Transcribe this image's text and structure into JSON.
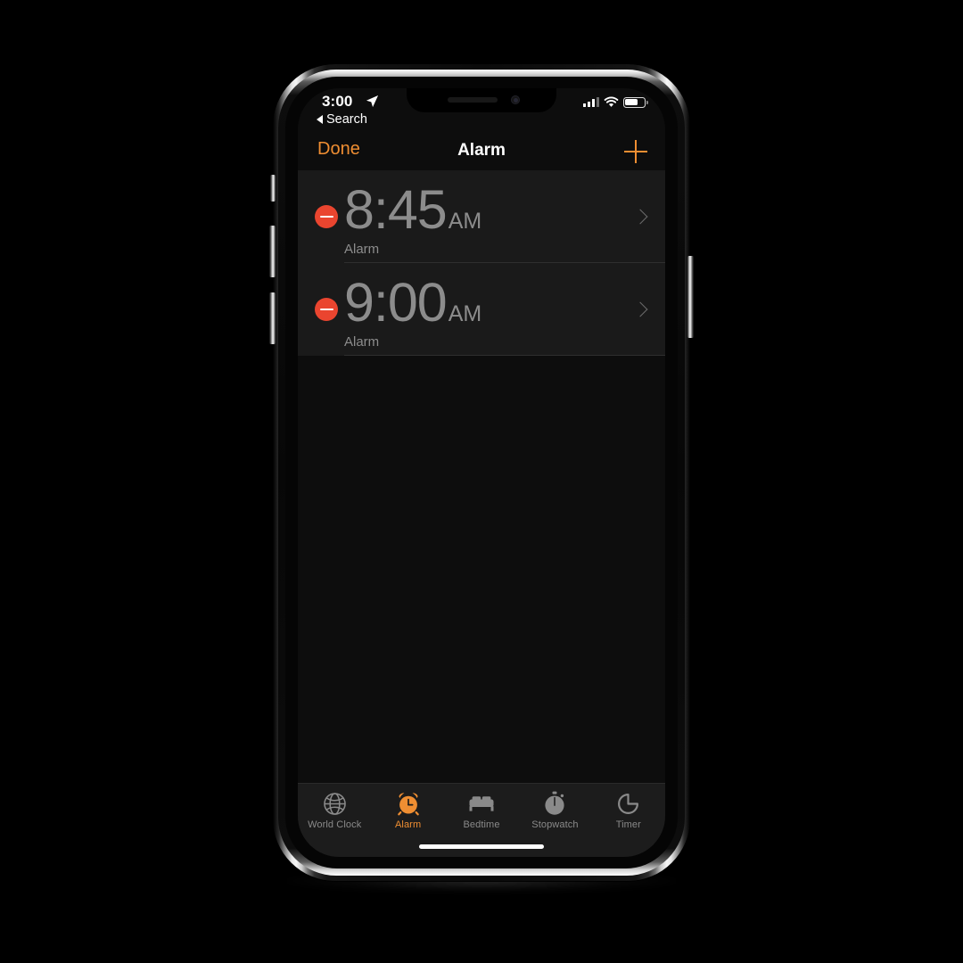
{
  "device": {
    "name": "iphone-x",
    "frame_color": "#c9c9c9"
  },
  "status_bar": {
    "time": "3:00",
    "location_icon": "location-arrow-icon",
    "signal_icon": "cellular-signal-icon",
    "signal_bars_filled": 3,
    "signal_bars_total": 4,
    "wifi_icon": "wifi-icon",
    "battery_icon": "battery-icon",
    "battery_percent": 58
  },
  "back_to_app": {
    "icon": "back-triangle-icon",
    "label": "Search"
  },
  "nav_bar": {
    "done_label": "Done",
    "title": "Alarm",
    "add_icon": "plus-icon",
    "accent_color": "#ef8e32"
  },
  "alarms": [
    {
      "delete_icon": "minus-circle-icon",
      "time": "8:45",
      "meridiem": "AM",
      "label": "Alarm",
      "chevron_icon": "chevron-right-icon",
      "enabled": false
    },
    {
      "delete_icon": "minus-circle-icon",
      "time": "9:00",
      "meridiem": "AM",
      "label": "Alarm",
      "chevron_icon": "chevron-right-icon",
      "enabled": false
    }
  ],
  "tab_bar": {
    "active_index": 1,
    "tabs": [
      {
        "icon": "globe-icon",
        "label": "World Clock"
      },
      {
        "icon": "alarm-clock-icon",
        "label": "Alarm"
      },
      {
        "icon": "bed-icon",
        "label": "Bedtime"
      },
      {
        "icon": "stopwatch-icon",
        "label": "Stopwatch"
      },
      {
        "icon": "timer-icon",
        "label": "Timer"
      }
    ]
  },
  "colors": {
    "accent_orange": "#ef8e32",
    "delete_red": "#ea452f",
    "row_bg": "#1a1a1a",
    "screen_bg": "#0d0d0d",
    "text_gray": "#8c8c8c"
  },
  "home_indicator": "home-indicator"
}
